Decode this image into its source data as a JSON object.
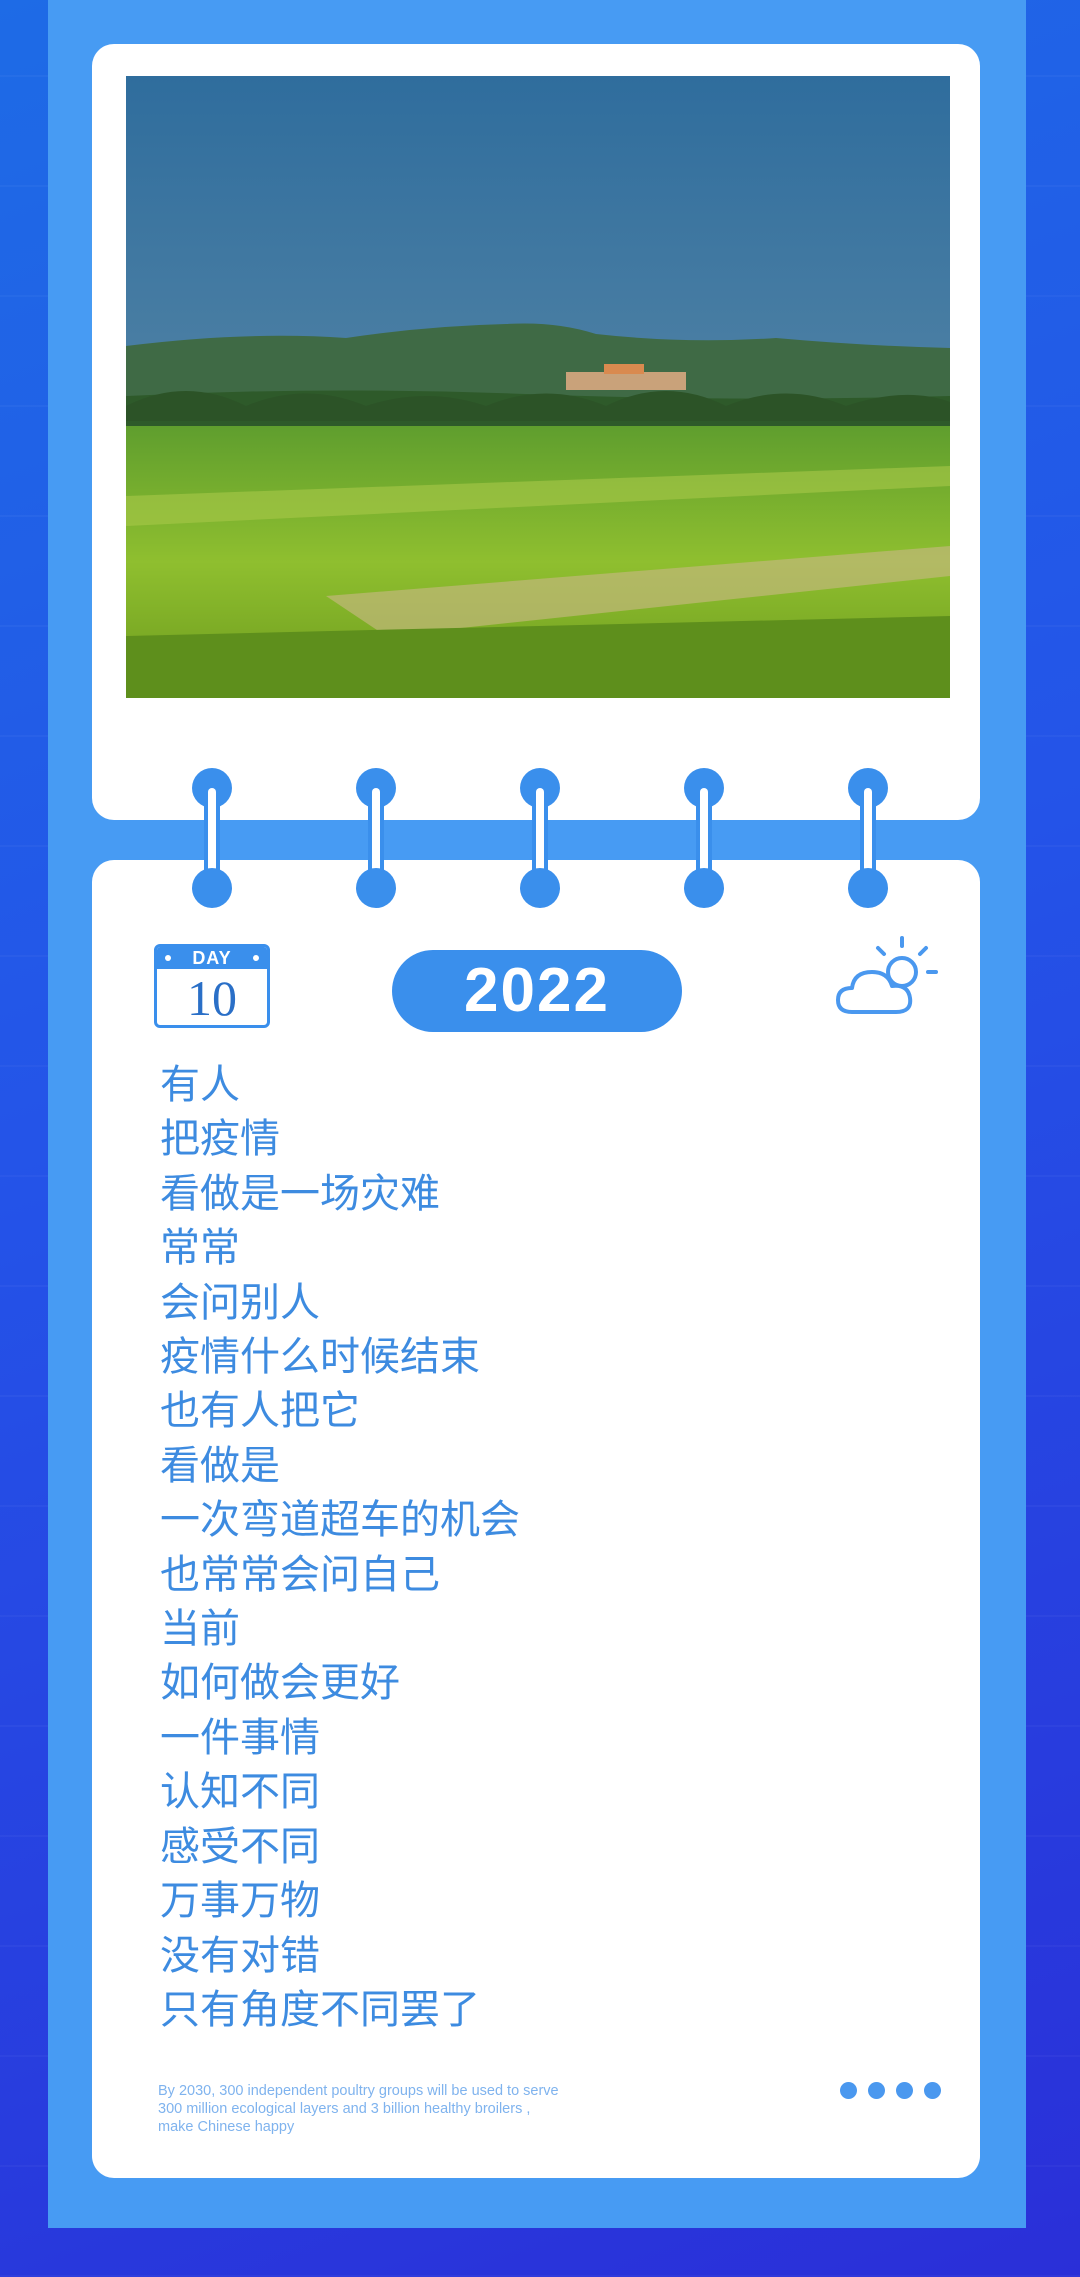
{
  "card": {
    "day_label": "DAY",
    "day_number": "10",
    "year": "2022",
    "weather_icon": "cloud-sun-icon"
  },
  "poem": {
    "lines": [
      "有人",
      "把疫情",
      "看做是一场灾难",
      "常常",
      "会问别人",
      "疫情什么时候结束",
      "也有人把它",
      "看做是",
      "一次弯道超车的机会",
      "也常常会问自己",
      "当前",
      "如何做会更好",
      "一件事情",
      "认知不同",
      "感受不同",
      "万事万物",
      "没有对错",
      "只有角度不同罢了"
    ]
  },
  "footnote": {
    "line1": "By 2030, 300 independent poultry groups will be used to serve",
    "line2": "300 million ecological layers  and 3 billion healthy broilers ,",
    "line3": "make Chinese happy"
  },
  "colors": {
    "frame": "#479bf3",
    "accent": "#3a8fec",
    "text": "#3d8be0",
    "background": "#2453e8"
  }
}
